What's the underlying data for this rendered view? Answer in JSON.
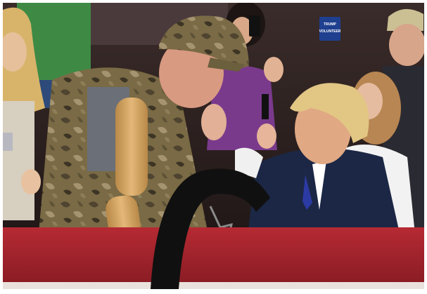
{
  "photo": {
    "badge_line_1": "TRUMP",
    "badge_line_2": "VOLUNTEER",
    "palette": {
      "banner_red": "#a3232c",
      "suit_navy": "#1c2745",
      "camo_brown": "#7a6a45",
      "prosthetic_tan": "#d2a567",
      "hair_blond": "#e2c684",
      "crowd_dark": "#2a1e1c"
    }
  }
}
